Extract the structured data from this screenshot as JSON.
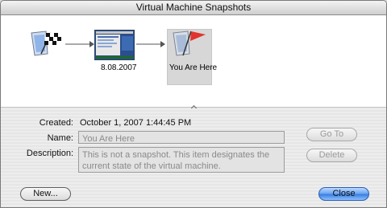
{
  "window": {
    "title": "Virtual Machine Snapshots"
  },
  "snapshots": [
    {
      "label": "",
      "icon": "start-flag-icon"
    },
    {
      "label": "8.08.2007",
      "icon": "vm-screen-thumbnail"
    },
    {
      "label": "You Are Here",
      "icon": "you-are-here-flag-icon"
    }
  ],
  "details": {
    "created_label": "Created:",
    "created_value": "October 1, 2007 1:44:45 PM",
    "name_label": "Name:",
    "name_value": "You Are Here",
    "description_label": "Description:",
    "description_value": "This is not a snapshot. This item designates the current state of the virtual machine."
  },
  "buttons": {
    "go_to": "Go To",
    "delete": "Delete",
    "new": "New...",
    "close": "Close"
  },
  "colors": {
    "accent": "#3b7fe0",
    "flag_red": "#e2332c"
  }
}
